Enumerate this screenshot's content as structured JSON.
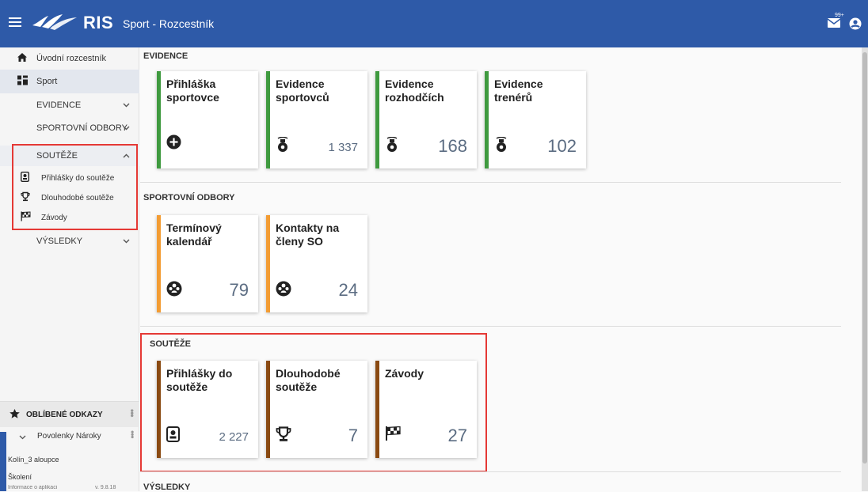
{
  "topbar": {
    "logo_text": "RIS",
    "app_title": "Sport - Rozcestník",
    "mail_badge": "99+"
  },
  "sidebar": {
    "items": [
      {
        "label": "Úvodní rozcestník",
        "icon": "home-icon"
      },
      {
        "label": "Sport",
        "icon": "grid-icon"
      },
      {
        "label": "EVIDENCE"
      },
      {
        "label": "SPORTOVNÍ ODBORY"
      },
      {
        "label": "SOUTĚŽE"
      },
      {
        "label": "Přihlášky do soutěže",
        "icon": "entry-form-icon"
      },
      {
        "label": "Dlouhodobé soutěže",
        "icon": "trophy-icon"
      },
      {
        "label": "Závody",
        "icon": "checkered-flag-icon"
      },
      {
        "label": "VÝSLEDKY"
      }
    ],
    "favorites": {
      "header": "OBLÍBENÉ ODKAZY",
      "group": "Povolenky Nároky",
      "links": [
        "Kolín_3 aloupce",
        "Školení",
        "Informace o aplikaci"
      ],
      "version": "v. 9.8.18"
    }
  },
  "sections": [
    {
      "title": "EVIDENCE",
      "color": "#3f9a3f",
      "cards": [
        {
          "title": "Přihláška sportovce",
          "icon": "plus-circle-icon",
          "count": ""
        },
        {
          "title": "Evidence sportovců",
          "icon": "whistle-icon",
          "count": "1 337"
        },
        {
          "title": "Evidence rozhodčích",
          "icon": "whistle-icon",
          "count": "168"
        },
        {
          "title": "Evidence trenérů",
          "icon": "whistle-icon",
          "count": "102"
        }
      ]
    },
    {
      "title": "SPORTOVNÍ ODBORY",
      "color": "#f39c33",
      "cards": [
        {
          "title": "Termínový kalendář",
          "icon": "group-icon",
          "count": "79"
        },
        {
          "title": "Kontakty na členy SO",
          "icon": "group-icon",
          "count": "24"
        }
      ]
    },
    {
      "title": "SOUTĚŽE",
      "color": "#8a4a12",
      "cards": [
        {
          "title": "Přihlášky do soutěže",
          "icon": "entry-form-icon",
          "count": "2 227"
        },
        {
          "title": "Dlouhodobé soutěže",
          "icon": "trophy-icon",
          "count": "7"
        },
        {
          "title": "Závody",
          "icon": "checkered-flag-icon",
          "count": "27"
        }
      ]
    },
    {
      "title": "VÝSLEDKY",
      "cards": []
    }
  ]
}
